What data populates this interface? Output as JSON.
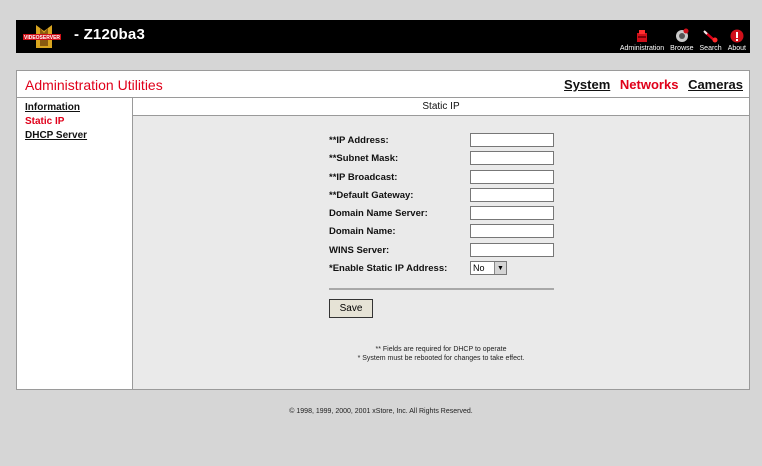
{
  "header": {
    "logo_text": "VIDEOSERVER",
    "device_name": "- Z120ba3",
    "nav": [
      {
        "label": "Administration",
        "icon": "admin-icon"
      },
      {
        "label": "Browse",
        "icon": "browse-icon"
      },
      {
        "label": "Search",
        "icon": "search-icon"
      },
      {
        "label": "About",
        "icon": "about-icon"
      }
    ]
  },
  "page": {
    "title": "Administration Utilities",
    "section_links": [
      {
        "label": "System",
        "active": false
      },
      {
        "label": "Networks",
        "active": true
      },
      {
        "label": "Cameras",
        "active": false
      }
    ]
  },
  "sidebar": {
    "items": [
      {
        "label": "Information",
        "active": false
      },
      {
        "label": "Static IP",
        "active": true
      },
      {
        "label": "DHCP Server",
        "active": false
      }
    ]
  },
  "content": {
    "header": "Static IP",
    "fields": [
      {
        "label": "**IP Address:",
        "value": ""
      },
      {
        "label": "**Subnet Mask:",
        "value": ""
      },
      {
        "label": "**IP Broadcast:",
        "value": ""
      },
      {
        "label": "**Default Gateway:",
        "value": ""
      },
      {
        "label": "Domain Name Server:",
        "value": ""
      },
      {
        "label": "Domain Name:",
        "value": ""
      },
      {
        "label": "WINS Server:",
        "value": ""
      }
    ],
    "enable_label": "*Enable Static IP Address:",
    "enable_value": "No",
    "save_label": "Save",
    "note1": "** Fields are required for DHCP to operate",
    "note2": "* System must be rebooted for changes to take effect."
  },
  "footer": "© 1998, 1999, 2000, 2001 xStore, Inc. All Rights Reserved.",
  "colors": {
    "accent": "#e0001a",
    "topbar": "#000000",
    "background": "#d6d6d6"
  }
}
